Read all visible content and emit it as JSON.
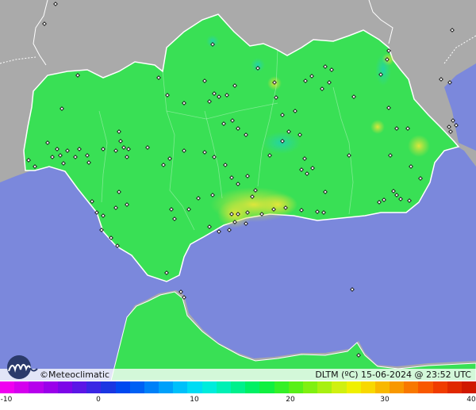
{
  "map": {
    "colors": {
      "sea": "#7b88dc",
      "land_outside": "#aaaaaa",
      "region": "#39e055",
      "region_warm": "#cfe43a",
      "region_cool": "#2ad7a0",
      "border": "#ffffff",
      "station": "#111111"
    }
  },
  "credit": {
    "icon": "meteoclimatic-logo-icon",
    "copyright": "©",
    "name": "Meteoclimatic"
  },
  "title": "DLTM (ºC)   15-06-2024 @ 23:52 UTC",
  "scale": {
    "ticks": [
      "-10",
      "0",
      "10",
      "20",
      "30",
      "40"
    ],
    "colors": [
      "#f000f0",
      "#d400ee",
      "#b600ec",
      "#9a00ea",
      "#7c06e8",
      "#5b16e6",
      "#3a26e4",
      "#1a36e2",
      "#0048f0",
      "#0060f4",
      "#0080f8",
      "#00a0fa",
      "#00c0fa",
      "#00dcf4",
      "#00ecdc",
      "#00f0b4",
      "#00f08c",
      "#00f064",
      "#10f040",
      "#34f028",
      "#58f018",
      "#80f010",
      "#a8f010",
      "#d0f010",
      "#f0f000",
      "#f8d800",
      "#f8b800",
      "#f89800",
      "#f87800",
      "#f85800",
      "#f03c00",
      "#e02800",
      "#d01800"
    ]
  }
}
